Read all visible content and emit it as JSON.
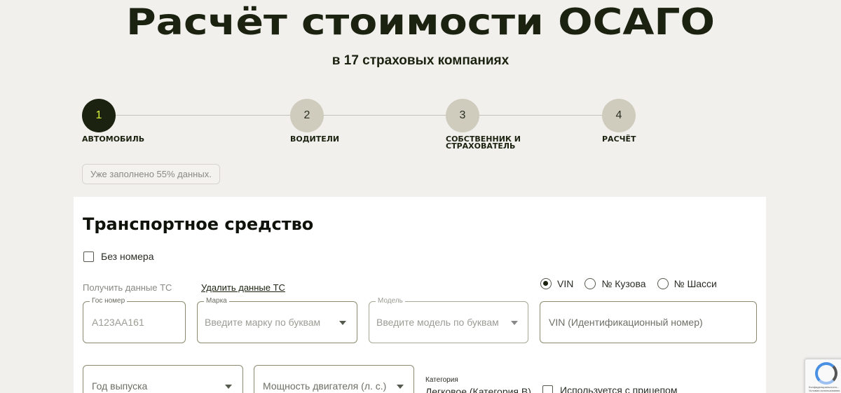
{
  "hero": {
    "title": "Расчёт стоимости ОСАГО",
    "subtitle": "в 17 страховых компаниях"
  },
  "steps": [
    {
      "number": "1",
      "label_line1": "Автомобиль",
      "label_line2": "",
      "active": true
    },
    {
      "number": "2",
      "label_line1": "Водители",
      "label_line2": "",
      "active": false
    },
    {
      "number": "3",
      "label_line1": "Собственник и",
      "label_line2": "страхователь",
      "active": false
    },
    {
      "number": "4",
      "label_line1": "Расчёт",
      "label_line2": "",
      "active": false
    }
  ],
  "progress_note": "Уже заполнено 55% данных.",
  "form": {
    "title": "Транспортное средство",
    "no_number_label": "Без номера",
    "get_data_label": "Получить данные ТС",
    "delete_data_label": "Удалить данные ТС",
    "id_type": {
      "options": [
        "VIN",
        "№ Кузова",
        "№ Шасси"
      ],
      "selected": "VIN"
    },
    "plate": {
      "legend": "Гос номер",
      "placeholder": "А123АА161"
    },
    "brand": {
      "legend": "Марка",
      "placeholder": "Введите марку по буквам"
    },
    "model": {
      "legend": "Модель",
      "placeholder": "Введите модель по буквам"
    },
    "vin": {
      "placeholder": "VIN (Идентификационный номер)"
    },
    "year": {
      "placeholder": "Год выпуска"
    },
    "power": {
      "placeholder": "Мощность двигателя (л. с.)"
    },
    "category": {
      "label": "Категория",
      "value": "Легковое (Категория B)"
    },
    "trailer_label": "Используется с прицепом"
  },
  "recaptcha": {
    "text_line1": "Конфиденциальность -",
    "text_line2": "Условия использования"
  }
}
